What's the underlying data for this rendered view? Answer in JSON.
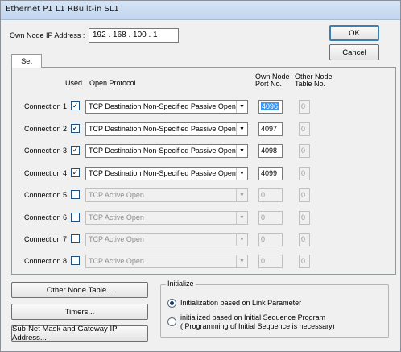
{
  "window": {
    "title": "Ethernet  P1 L1 RBuilt-in SL1"
  },
  "ip": {
    "label": "Own Node IP Address :",
    "value": "192 . 168 . 100 .  1"
  },
  "buttons": {
    "ok": "OK",
    "cancel": "Cancel",
    "other_node_table": "Other Node Table...",
    "timers": "Timers...",
    "subnet": "Sub-Net Mask and Gateway IP Address..."
  },
  "tab": {
    "label": "Set"
  },
  "headers": {
    "used": "Used",
    "open_protocol": "Open Protocol",
    "own_port_line1": "Own Node",
    "own_port_line2": "Port No.",
    "other_table_line1": "Other Node",
    "other_table_line2": "Table No."
  },
  "connections": [
    {
      "label": "Connection 1",
      "used": true,
      "protocol": "TCP Destination Non-Specified Passive Open",
      "port": "4096",
      "table": "0"
    },
    {
      "label": "Connection 2",
      "used": true,
      "protocol": "TCP Destination Non-Specified Passive Open",
      "port": "4097",
      "table": "0"
    },
    {
      "label": "Connection 3",
      "used": true,
      "protocol": "TCP Destination Non-Specified Passive Open",
      "port": "4098",
      "table": "0"
    },
    {
      "label": "Connection 4",
      "used": true,
      "protocol": "TCP Destination Non-Specified Passive Open",
      "port": "4099",
      "table": "0"
    },
    {
      "label": "Connection 5",
      "used": false,
      "protocol": "TCP Active Open",
      "port": "0",
      "table": "0"
    },
    {
      "label": "Connection 6",
      "used": false,
      "protocol": "TCP Active Open",
      "port": "0",
      "table": "0"
    },
    {
      "label": "Connection 7",
      "used": false,
      "protocol": "TCP Active Open",
      "port": "0",
      "table": "0"
    },
    {
      "label": "Connection 8",
      "used": false,
      "protocol": "TCP Active Open",
      "port": "0",
      "table": "0"
    }
  ],
  "initialize": {
    "legend": "Initialize",
    "option1": "Initialization based on Link Parameter",
    "option2_line1": "initialized based on Initial Sequence Program",
    "option2_line2": "( Programming of Initial Sequence is necessary)",
    "selected": 1
  },
  "icons": {
    "check": "✓",
    "dropdown": "▼"
  }
}
